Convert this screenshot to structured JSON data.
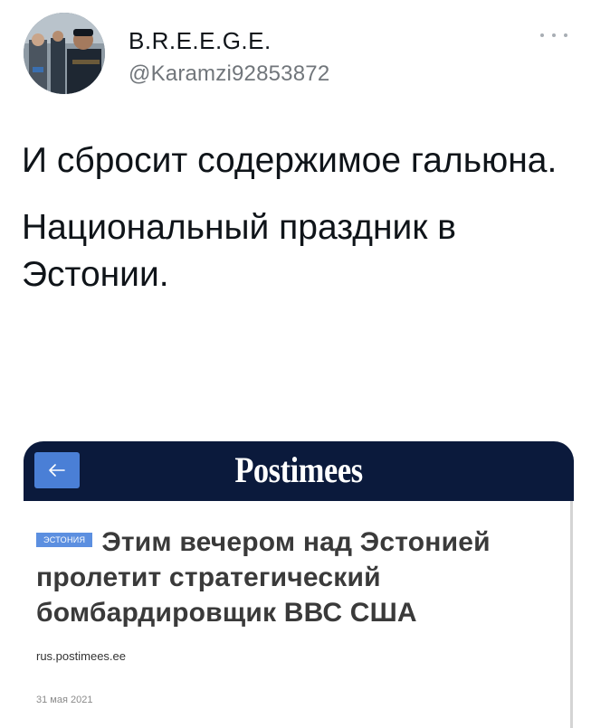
{
  "tweet": {
    "author": {
      "display_name": "B.R.E.E.G.E.",
      "handle": "@Karamzi92853872"
    },
    "more_icon": "more-horizontal-icon",
    "paragraphs": [
      "И сбросит содержимое гальюна.",
      "Национальный праздник в Эстонии."
    ]
  },
  "embed": {
    "back_icon": "arrow-left-icon",
    "logo_text": "Postimees",
    "tag": "ЭСТОНИЯ",
    "headline": "Этим вечером над Эстонией пролетит стратегический бомбардировщик ВВС США",
    "source_url": "rus.postimees.ee",
    "date": "31 мая 2021"
  },
  "colors": {
    "header_bar": "#0b1a3c",
    "back_button": "#4a7fd6",
    "tag_background": "#5c8fe0",
    "handle_text": "#71767b"
  }
}
